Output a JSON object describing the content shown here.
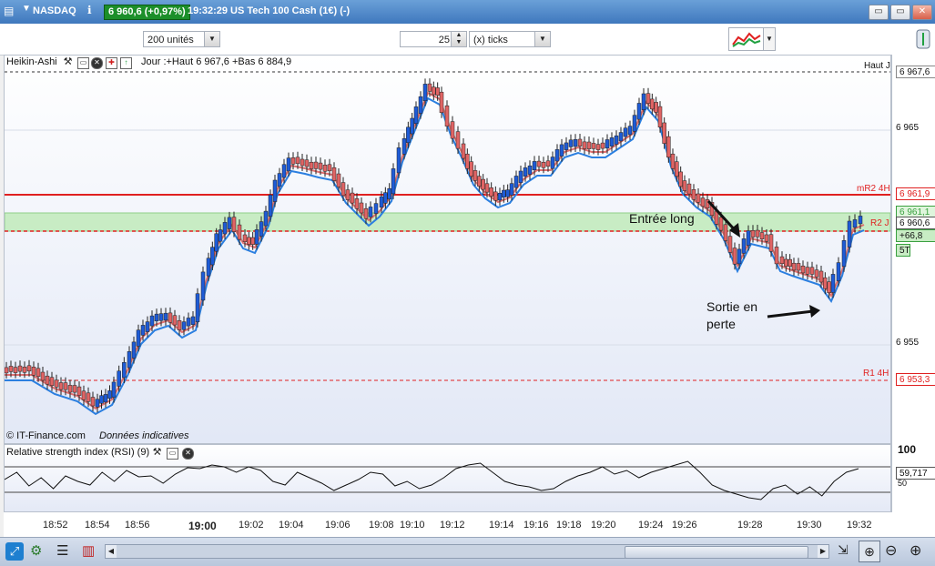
{
  "window": {
    "symbol": "NASDAQ",
    "price_badge": "6 960,6 (+0,97%)",
    "time": "19:32:29",
    "instrument": "US Tech 100 Cash (1€) (-)",
    "btn_min": "▭",
    "btn_restore": "▭",
    "btn_close": "✕"
  },
  "toolbar": {
    "units_value": "200 unités",
    "ticks_value": "25",
    "ticks_label": "(x) ticks"
  },
  "chart": {
    "indicator_name": "Heikin-Ashi",
    "day_info": "Jour :+Haut 6 967,6 +Bas 6 884,9",
    "copyright": "© IT-Finance.com",
    "disclaimer": "Données indicatives",
    "annotation_entry": "Entrée long",
    "annotation_exit_1": "Sortie en",
    "annotation_exit_2": "perte",
    "lines": {
      "haut_j": "Haut J",
      "mr2_4h": "mR2 4H",
      "r2_j": "R2 J",
      "r1_4h": "R1 4H"
    },
    "y_ticks": [
      "6 965",
      "6 955"
    ],
    "price_tags": {
      "haut": "6 967,6",
      "mr2": "6 961,9",
      "last": "6 960,6",
      "zone_top": "6 961,1",
      "gain": "+66,8",
      "r1": "6 953,3",
      "timeframe": "5T"
    },
    "colors": {
      "up": "#1e5bd6",
      "down": "#e06464",
      "zone": "#c8ecc4",
      "red_line": "#e02020",
      "blue_ma": "#2b7fe0",
      "red_ma": "#e07070"
    }
  },
  "rsi": {
    "label": "Relative strength index (RSI) (9)",
    "axis_top": "100",
    "value": "59,717",
    "axis_mid": "50"
  },
  "x_axis": [
    "18:52",
    "18:54",
    "18:56",
    "19:00",
    "19:02",
    "19:04",
    "19:06",
    "19:08",
    "19:10",
    "19:12",
    "19:14",
    "19:16",
    "19:18",
    "19:20",
    "19:24",
    "19:26",
    "19:28",
    "19:30",
    "19:32"
  ],
  "chart_data": {
    "type": "candlestick",
    "series": [
      {
        "name": "Heikin-Ashi",
        "values": []
      }
    ],
    "ylim": [
      6950,
      6968
    ]
  }
}
